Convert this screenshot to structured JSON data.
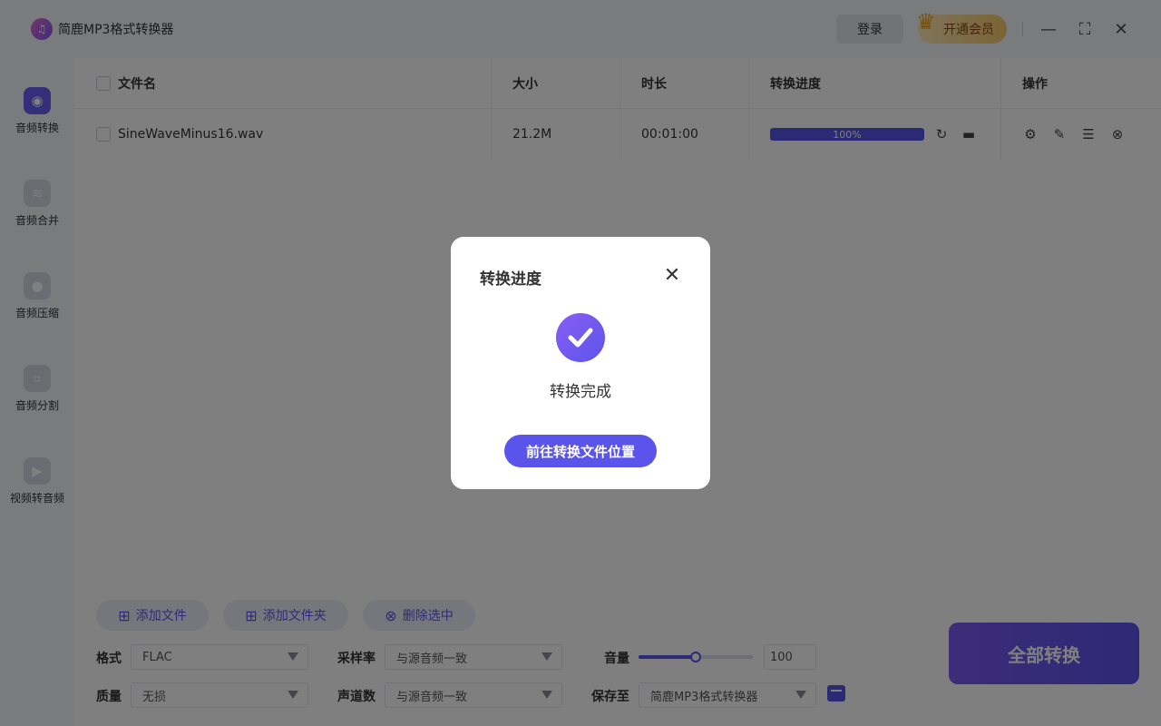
{
  "app": {
    "title": "简鹿MP3格式转换器"
  },
  "header": {
    "login_label": "登录",
    "vip_label": "开通会员"
  },
  "window": {
    "minimize": "—",
    "maximize": "⛶",
    "close": "✕"
  },
  "sidebar": {
    "items": [
      {
        "label": "音频转换",
        "icon": "disc-icon",
        "active": true
      },
      {
        "label": "音频合并",
        "icon": "merge-icon",
        "active": false
      },
      {
        "label": "音频压缩",
        "icon": "mic-icon",
        "active": false
      },
      {
        "label": "音频分割",
        "icon": "crop-icon",
        "active": false
      },
      {
        "label": "视频转音频",
        "icon": "video-icon",
        "active": false
      }
    ]
  },
  "table": {
    "columns": [
      "文件名",
      "大小",
      "时长",
      "转换进度",
      "操作"
    ],
    "rows": [
      {
        "filename": "SineWaveMinus16.wav",
        "size": "21.2M",
        "duration": "00:01:00",
        "progress": "100%"
      }
    ]
  },
  "toolbar": {
    "add_file": "添加文件",
    "add_folder": "添加文件夹",
    "delete_selected": "删除选中"
  },
  "options": {
    "format_label": "格式",
    "format_value": "FLAC",
    "quality_label": "质量",
    "quality_value": "无损",
    "samplerate_label": "采样率",
    "samplerate_value": "与源音频一致",
    "channels_label": "声道数",
    "channels_value": "与源音频一致",
    "volume_label": "音量",
    "volume_value": "100",
    "saveto_label": "保存至",
    "saveto_value": "简鹿MP3格式转换器"
  },
  "convert_all_label": "全部转换",
  "modal": {
    "title": "转换进度",
    "message": "转换完成",
    "button": "前往转换文件位置"
  },
  "colors": {
    "accent": "#5b54ea",
    "vip": "#f7c86a"
  }
}
